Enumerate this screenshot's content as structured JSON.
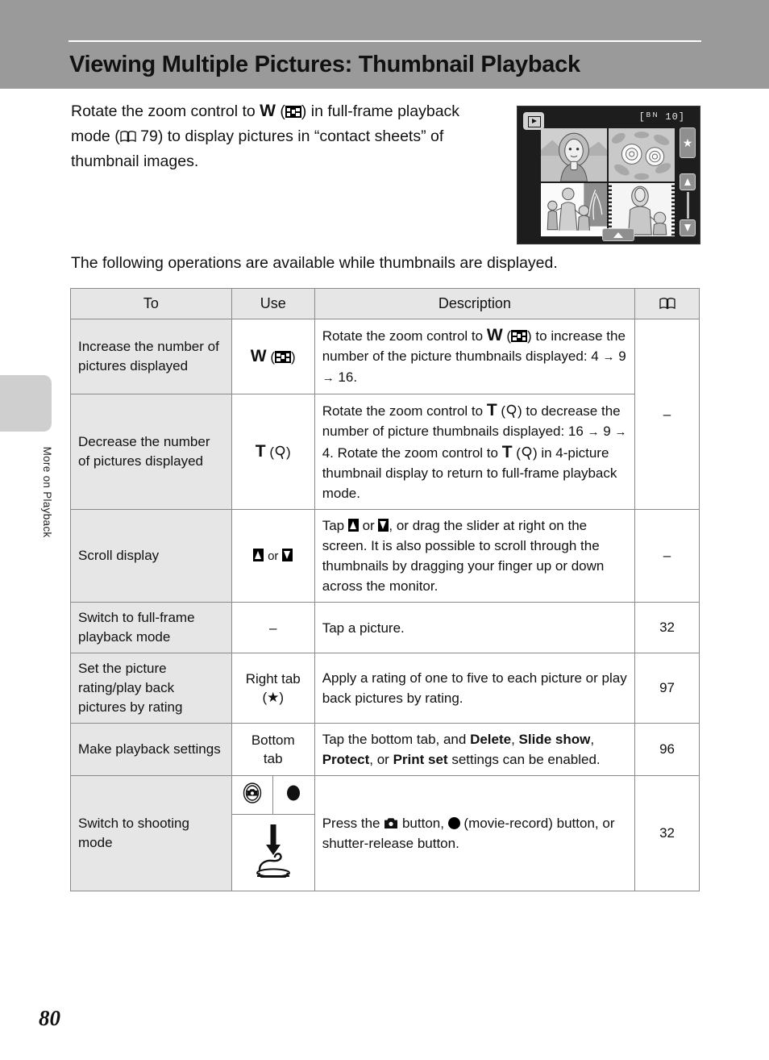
{
  "page": {
    "title": "Viewing Multiple Pictures: Thumbnail Playback",
    "number": "80",
    "side_tab_label": "More on Playback"
  },
  "intro": {
    "part1": "Rotate the zoom control to ",
    "w_letter": "W",
    "part2": ") in full-frame",
    "part3": "playback mode (",
    "page_ref": "79",
    "part4": ") to display pictures in “contact",
    "part5": "sheets” of thumbnail images.",
    "lead_in": "The following operations are available while thumbnails are displayed."
  },
  "camera_screen": {
    "play_icon": "play-icon",
    "counter": "[ᴮᴺ 10]",
    "star_tab": "★",
    "thumbnails": [
      "portrait-woman-mountains",
      "flowers-roses",
      "family-with-tree",
      "mother-and-child-movie"
    ]
  },
  "table": {
    "headers": {
      "to": "To",
      "use": "Use",
      "description": "Description",
      "ref": "book-icon"
    },
    "rows": [
      {
        "to": "Increase the number of pictures displayed",
        "use_letter": "W",
        "use_icon": "thumbnail-grid-icon",
        "desc_a": "Rotate the zoom control to ",
        "desc_letter": "W",
        "desc_b": ") to increase the number of the picture thumbnails displayed: 4 ",
        "arrow1": "→",
        "n1": " 9 ",
        "arrow2": "→",
        "n2": " 16.",
        "ref": "–"
      },
      {
        "to": "Decrease the number of pictures displayed",
        "use_letter": "T",
        "use_icon": "magnifier-icon",
        "desc_a": "Rotate the zoom control to ",
        "desc_b": ") to decrease the number of picture thumbnails displayed: 16 ",
        "arrow1": "→",
        "n1": " 9 ",
        "arrow2": "→",
        "n2": " 4. Rotate the zoom control to ",
        "desc_c": ") in 4-picture thumbnail display to return to full-frame playback mode.",
        "ref": ""
      },
      {
        "to": "Scroll display",
        "use_or": "or",
        "desc_a": "Tap ",
        "desc_or": " or ",
        "desc_b": ", or drag the slider at right on the screen. It is also possible to scroll through the thumbnails by dragging your finger up or down across the monitor.",
        "ref": "–"
      },
      {
        "to": "Switch to full-frame playback mode",
        "use": "–",
        "desc": "Tap a picture.",
        "ref": "32"
      },
      {
        "to": "Set the picture rating/play back pictures by rating",
        "use_line1": "Right tab",
        "use_line2_open": "(",
        "use_star": "★",
        "use_line2_close": ")",
        "desc": "Apply a rating of one to five to each picture or play back pictures by rating.",
        "ref": "97"
      },
      {
        "to": "Make playback settings",
        "use_line1": "Bottom",
        "use_line2": "tab",
        "desc_a": "Tap the bottom tab, and ",
        "b1": "Delete",
        "sep1": ", ",
        "b2": "Slide show",
        "sep2": ", ",
        "b3": "Protect",
        "sep3": ", or ",
        "b4": "Print set",
        "desc_b": " settings can be enabled.",
        "ref": "96"
      },
      {
        "to": "Switch to shooting mode",
        "use_icons": [
          "camera-button-icon",
          "movie-record-dot-icon",
          "shutter-press-icon"
        ],
        "desc_a": "Press the ",
        "desc_b": " button, ",
        "desc_c": " (movie-record) button, or shutter-release button.",
        "ref": "32"
      }
    ]
  }
}
